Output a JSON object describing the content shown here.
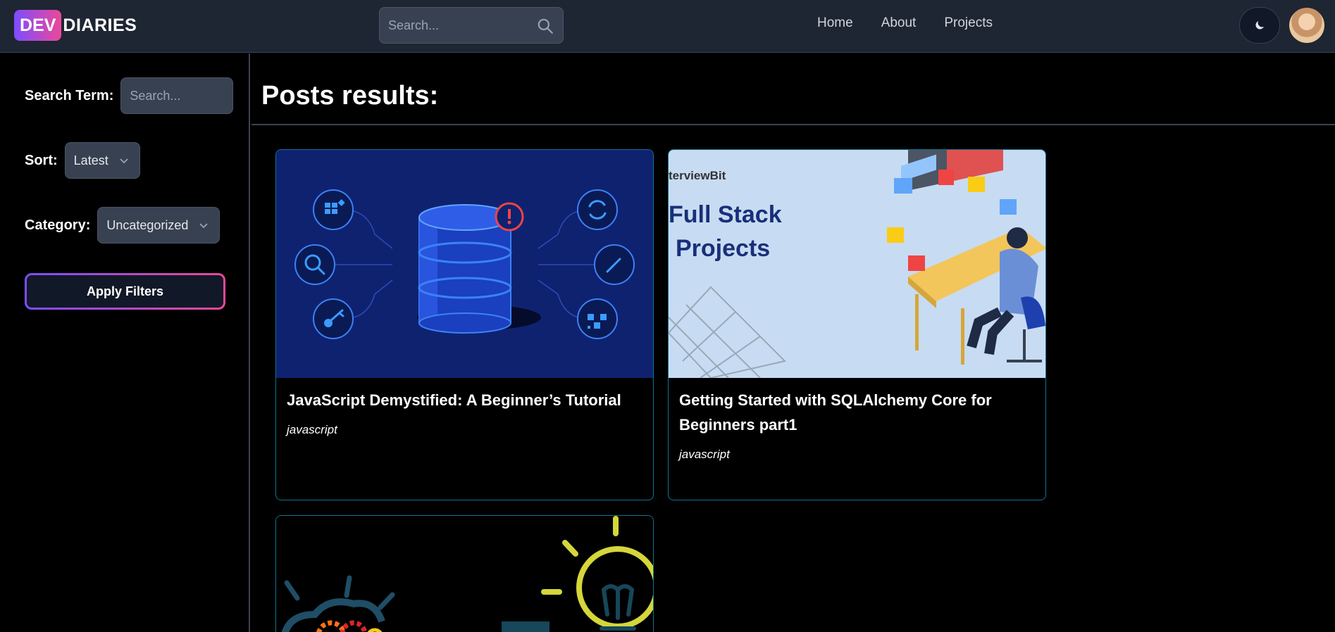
{
  "brand": {
    "part1": "DEV",
    "part2": "DIARIES"
  },
  "header": {
    "search_placeholder": "Search...",
    "nav": [
      "Home",
      "About",
      "Projects"
    ]
  },
  "sidebar": {
    "search_label": "Search Term:",
    "search_placeholder": "Search...",
    "sort_label": "Sort:",
    "sort_value": "Latest",
    "category_label": "Category:",
    "category_value": "Uncategorized",
    "apply_label": "Apply Filters"
  },
  "main": {
    "title": "Posts results:",
    "posts": [
      {
        "title": "JavaScript Demystified: A Beginner’s Tutorial",
        "tag": "javascript"
      },
      {
        "title": "Getting Started with SQLAlchemy Core for Beginners part1",
        "tag": "javascript",
        "image_text": {
          "brand": "terviewBit",
          "headline_1": "Full Stack",
          "headline_2": "Projects"
        }
      },
      {
        "title": "",
        "tag": ""
      }
    ]
  },
  "colors": {
    "accent_start": "#7c4dff",
    "accent_end": "#ec4899",
    "card_border": "#0e7490",
    "header_bg": "#1e2533"
  }
}
